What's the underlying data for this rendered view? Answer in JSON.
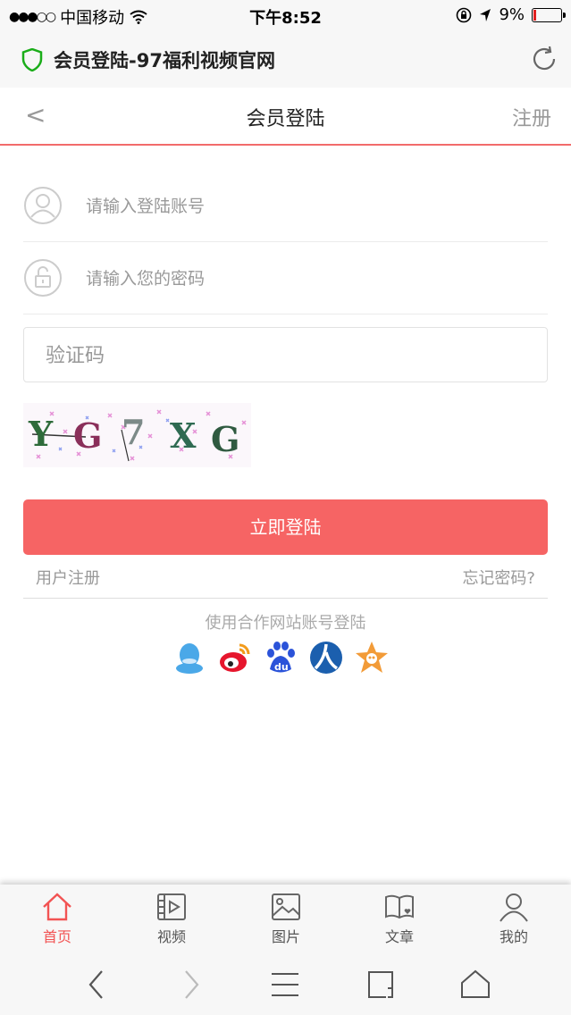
{
  "status": {
    "carrier": "中国移动",
    "time": "下午8:52",
    "battery": "9%",
    "battery_level": 0.09
  },
  "browser": {
    "page_title": "会员登陆-97福利视频官网"
  },
  "nav": {
    "back": "<",
    "title": "会员登陆",
    "register": "注册"
  },
  "form": {
    "account_placeholder": "请输入登陆账号",
    "password_placeholder": "请输入您的密码",
    "captcha_placeholder": "验证码",
    "captcha_chars": [
      "Y",
      "G",
      "7",
      "X",
      "G"
    ],
    "login_button": "立即登陆",
    "user_register": "用户注册",
    "forgot_password": "忘记密码?",
    "partner_login": "使用合作网站账号登陆"
  },
  "social": [
    "qq-icon",
    "weibo-icon",
    "baidu-icon",
    "renren-icon",
    "kaixin-icon"
  ],
  "tabs": [
    {
      "label": "首页",
      "icon": "home-icon",
      "active": true
    },
    {
      "label": "视频",
      "icon": "video-icon",
      "active": false
    },
    {
      "label": "图片",
      "icon": "image-icon",
      "active": false
    },
    {
      "label": "文章",
      "icon": "book-icon",
      "active": false
    },
    {
      "label": "我的",
      "icon": "user-icon",
      "active": false
    }
  ],
  "colors": {
    "accent": "#f66464",
    "active_tab": "#f25353"
  }
}
